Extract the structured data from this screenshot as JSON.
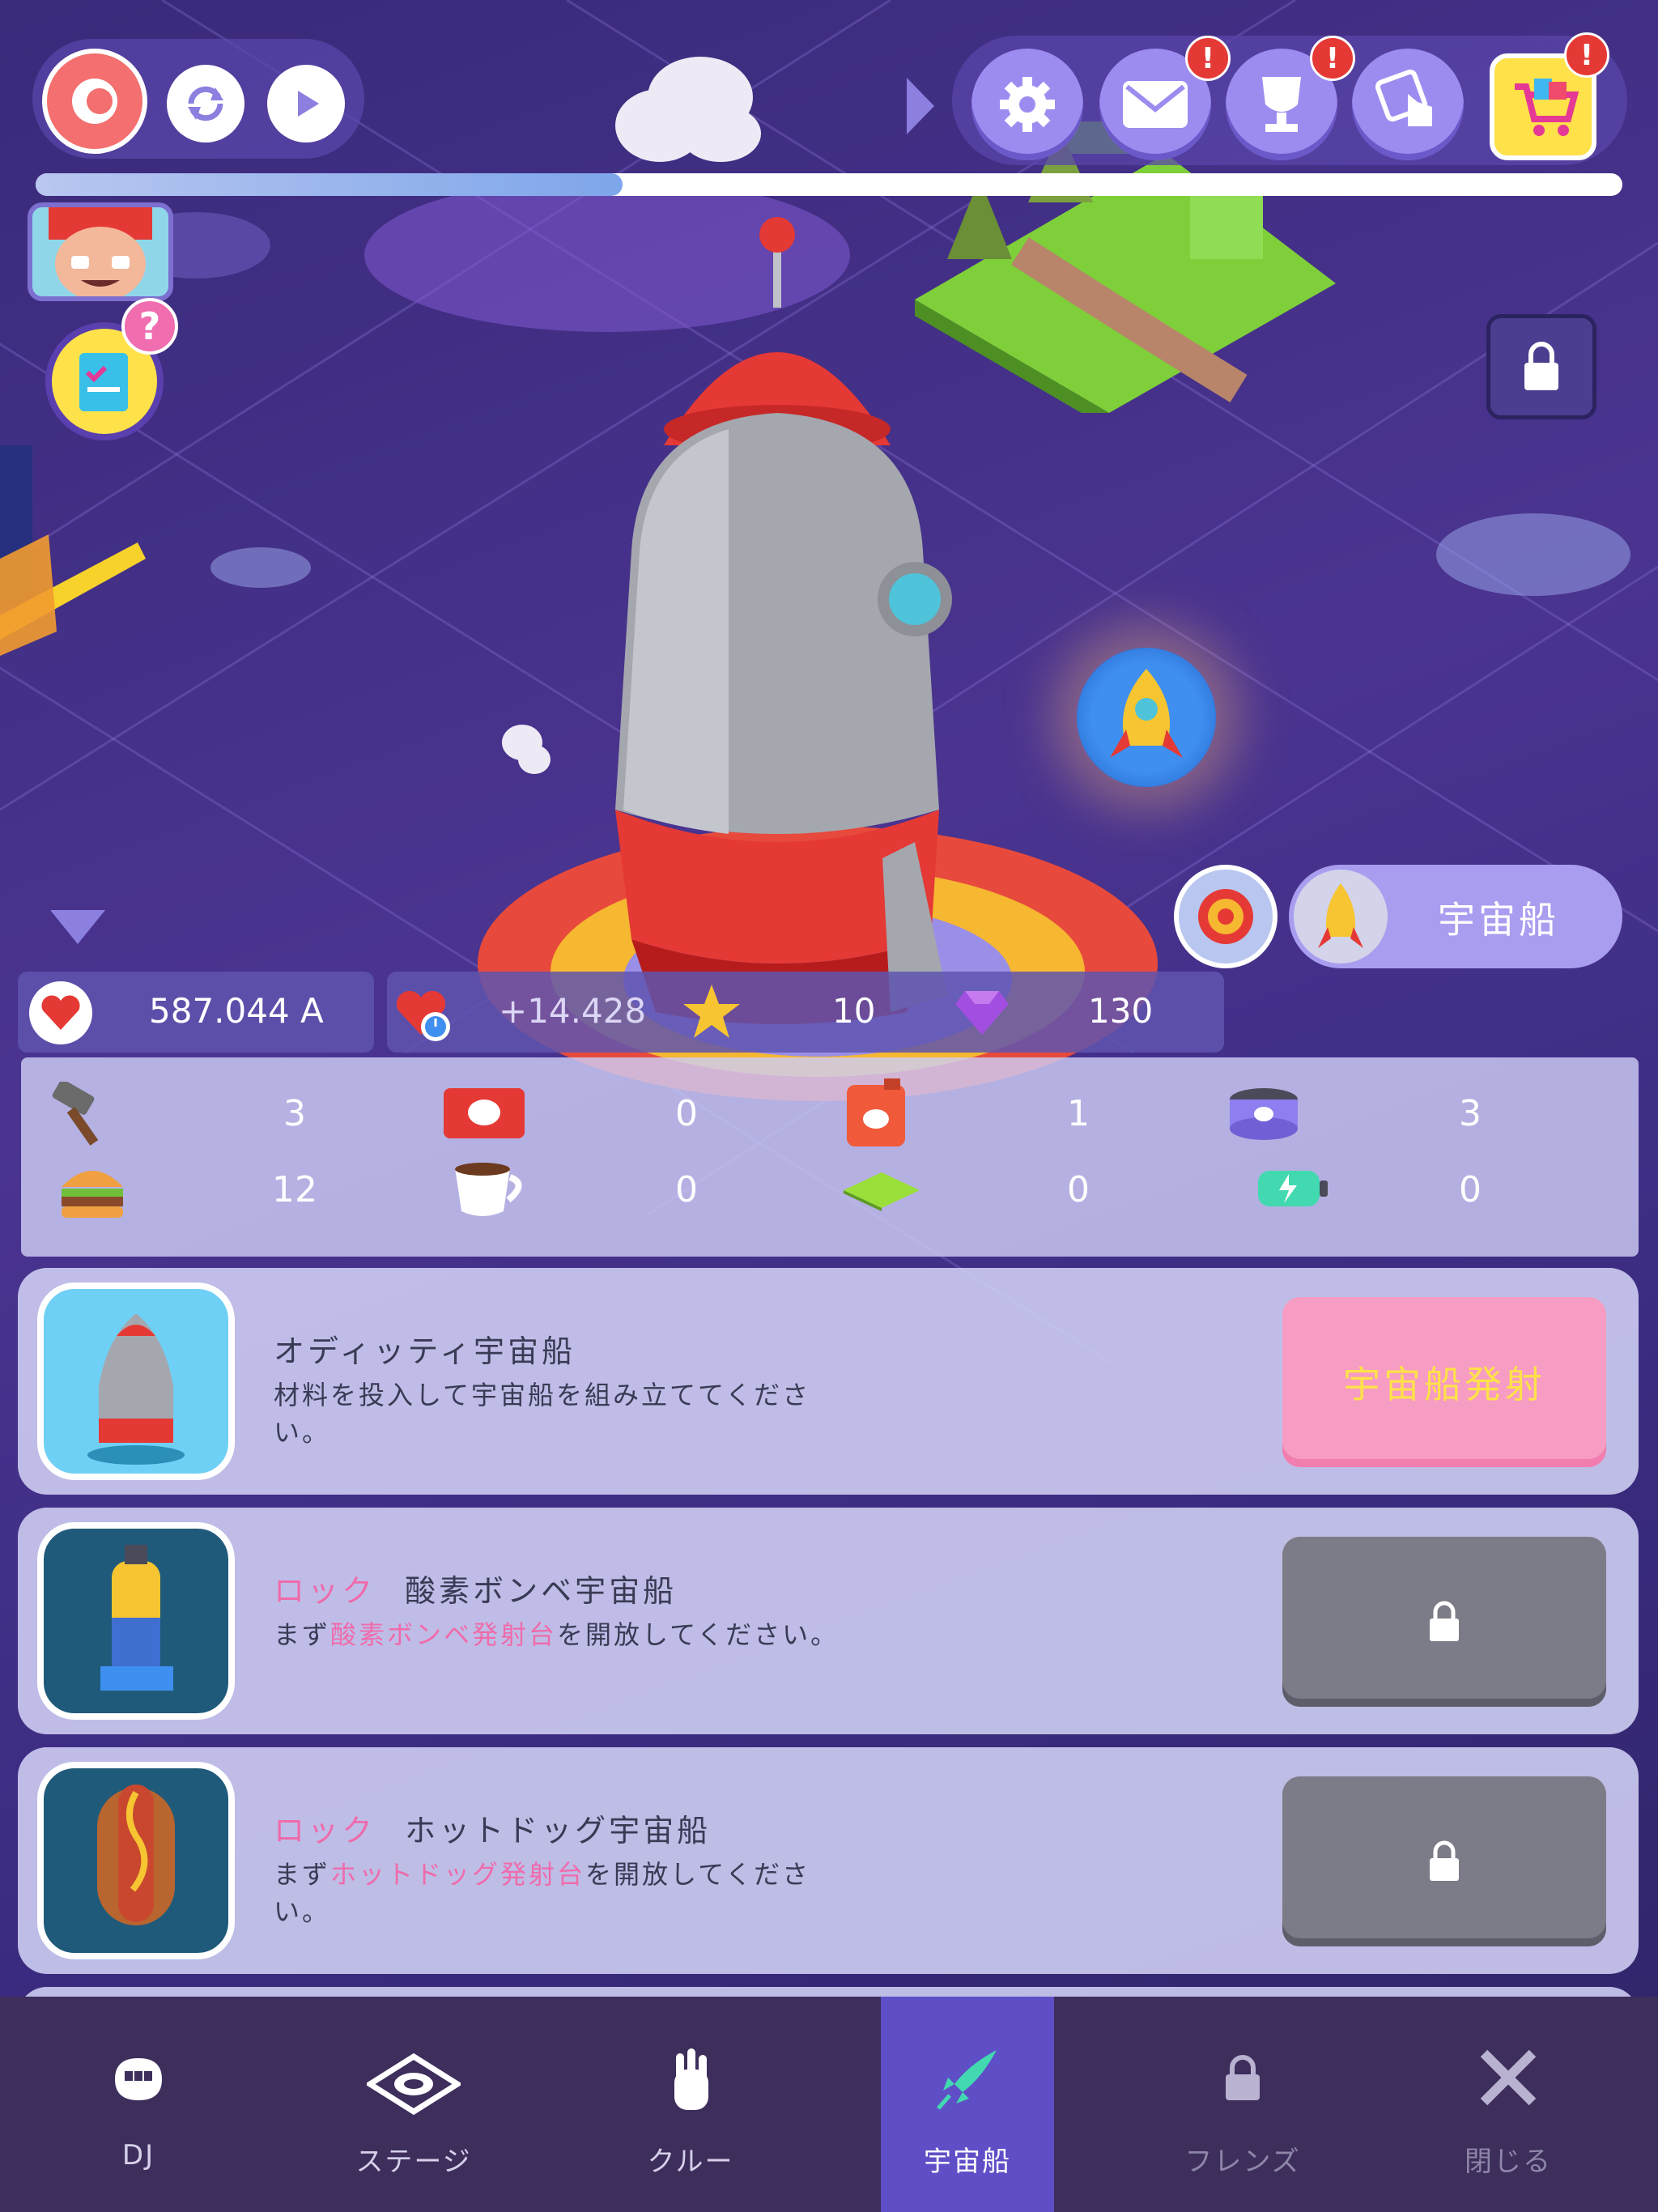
{
  "top": {
    "progress_fraction": 0.37
  },
  "currency": {
    "hearts": "587.044 A",
    "hearts_rate": "+14.428",
    "stars": "10",
    "gems": "130"
  },
  "spaceship_button": {
    "label": "宇宙船"
  },
  "resources": {
    "row1": [
      "3",
      "0",
      "1",
      "3"
    ],
    "row2": [
      "12",
      "0",
      "0",
      "0"
    ]
  },
  "ships": [
    {
      "title": "オディッティ宇宙船",
      "desc": "材料を投入して宇宙船を組み立ててください。",
      "button": "宇宙船発射"
    },
    {
      "lock_label": "ロック",
      "title": "酸素ボンベ宇宙船",
      "desc_pre": "まず",
      "desc_highlight": "酸素ボンベ発射台",
      "desc_post": "を開放してください。"
    },
    {
      "lock_label": "ロック",
      "title": "ホットドッグ宇宙船",
      "desc_pre": "まず",
      "desc_highlight": "ホットドッグ発射台",
      "desc_post": "を開放してください。"
    }
  ],
  "nav": {
    "items": [
      {
        "label": "DJ",
        "icon": "mouth-icon"
      },
      {
        "label": "ステージ",
        "icon": "stage-icon"
      },
      {
        "label": "クルー",
        "icon": "hand-icon"
      },
      {
        "label": "宇宙船",
        "icon": "rocket-icon",
        "active": true
      },
      {
        "label": "フレンズ",
        "icon": "lock-icon"
      },
      {
        "label": "閉じる",
        "icon": "close-icon"
      }
    ]
  },
  "colors": {
    "accent": "#5f4fc7",
    "launch_button": "#f79cc2",
    "locked_button": "#7c7c88",
    "nav_bg": "#3d2e5c",
    "nav_active": "#5f4fc7"
  }
}
